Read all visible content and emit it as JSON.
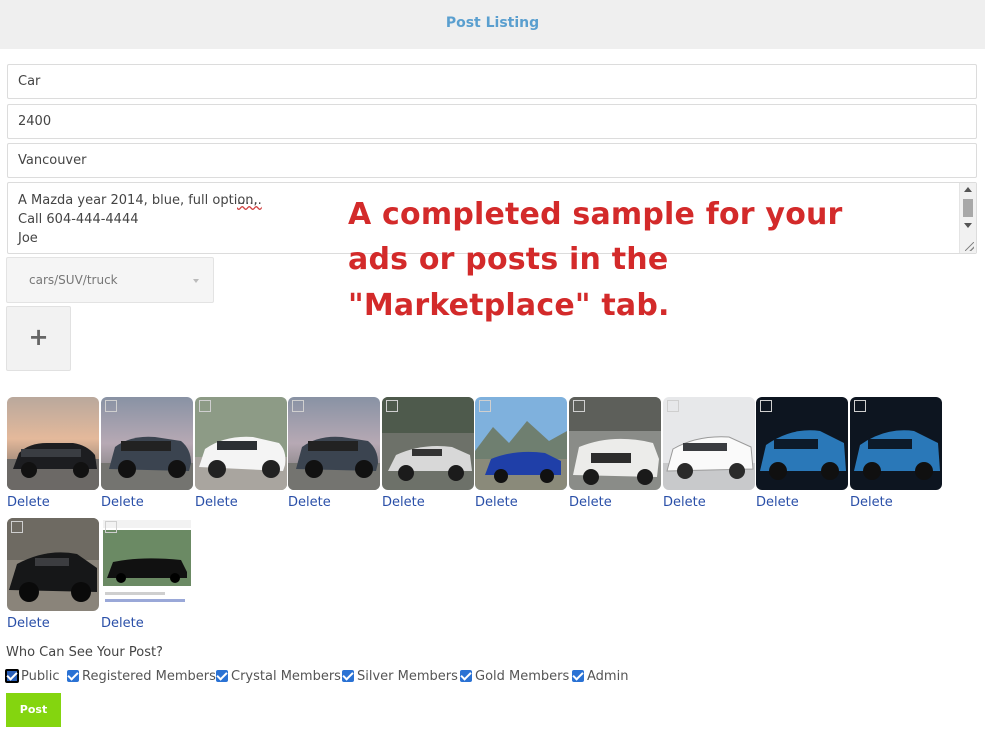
{
  "header": {
    "title": "Post Listing"
  },
  "form": {
    "title_value": "Car",
    "price_value": "2400",
    "location_value": "Vancouver",
    "description": {
      "line1": "A Mazda year 2014, blue, full option, ",
      "line1_suffix": "......",
      "line2": "Call 604-444-4444",
      "line3": "Joe"
    },
    "category": "cars/SUV/truck",
    "add_photo": "+"
  },
  "note": {
    "line1": "A completed sample for your",
    "line2": "ads or posts in the",
    "line3": "\"Marketplace\" tab."
  },
  "photos": [
    {
      "delete_label": "Delete",
      "subject": "black SUV at sunset"
    },
    {
      "delete_label": "Delete",
      "subject": "dark grey crossover"
    },
    {
      "delete_label": "Delete",
      "subject": "white sedan"
    },
    {
      "delete_label": "Delete",
      "subject": "dark grey crossover"
    },
    {
      "delete_label": "Delete",
      "subject": "silver sports car"
    },
    {
      "delete_label": "Delete",
      "subject": "blue convertible"
    },
    {
      "delete_label": "Delete",
      "subject": "white supercar"
    },
    {
      "delete_label": "Delete",
      "subject": "white electric sedan"
    },
    {
      "delete_label": "Delete",
      "subject": "blue compact car"
    },
    {
      "delete_label": "Delete",
      "subject": "blue compact car"
    },
    {
      "delete_label": "Delete",
      "subject": "black sports car"
    },
    {
      "delete_label": "Delete",
      "subject": "black vintage sedan post"
    }
  ],
  "visibility": {
    "label": "Who Can See Your Post?",
    "options": [
      {
        "label": "Public",
        "checked": true
      },
      {
        "label": "Registered Members",
        "checked": true
      },
      {
        "label": "Crystal Members",
        "checked": true
      },
      {
        "label": "Silver Members",
        "checked": true
      },
      {
        "label": "Gold Members",
        "checked": true
      },
      {
        "label": "Admin",
        "checked": true
      }
    ]
  },
  "actions": {
    "post_label": "Post"
  },
  "colors": {
    "header_text": "#5a9fcf",
    "note_text": "#d32a2a",
    "link": "#2a4fa8",
    "post_button": "#84d50f",
    "checkbox": "#2a72d4"
  }
}
